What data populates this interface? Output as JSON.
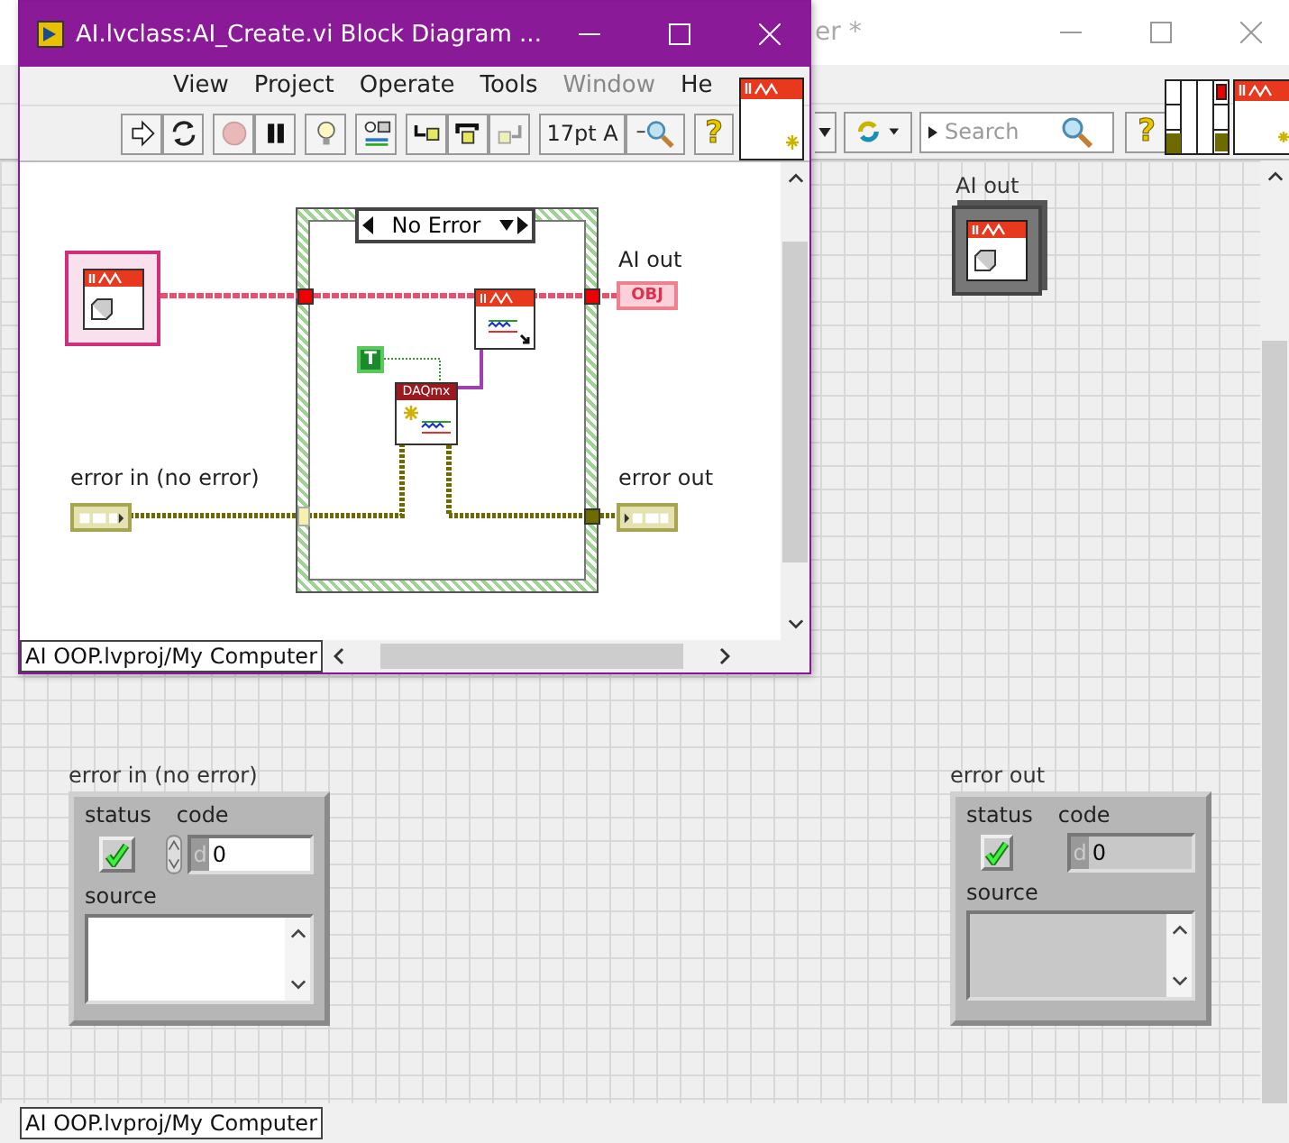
{
  "block_diagram_window": {
    "title": "AI.lvclass:AI_Create.vi Block Diagram ...",
    "menu": [
      {
        "label": "View",
        "disabled": false
      },
      {
        "label": "Project",
        "disabled": false
      },
      {
        "label": "Operate",
        "disabled": false
      },
      {
        "label": "Tools",
        "disabled": false
      },
      {
        "label": "Window",
        "disabled": true
      },
      {
        "label": "He",
        "disabled": false
      }
    ],
    "toolbar": {
      "buttons": [
        {
          "kind": "run",
          "disabled": false
        },
        {
          "kind": "run-continuously",
          "disabled": false
        },
        {
          "kind": "abort",
          "disabled": true
        },
        {
          "kind": "pause",
          "disabled": false
        },
        {
          "kind": "highlight",
          "disabled": false
        },
        {
          "kind": "retain",
          "disabled": false
        },
        {
          "kind": "step-into",
          "disabled": false
        },
        {
          "kind": "step-over",
          "disabled": false
        },
        {
          "kind": "step-out",
          "disabled": true
        }
      ],
      "font": "17pt A",
      "help": "?"
    },
    "diagram": {
      "case_selector": "No Error",
      "ai_out": {
        "label": "AI out",
        "text": "OBJ"
      },
      "error_in": {
        "label": "error in (no error)"
      },
      "error_out": {
        "label": "error out"
      },
      "boolean_constant": "T",
      "daqmx_node": "DAQmx"
    },
    "status_bar": "AI OOP.lvproj/My Computer"
  },
  "front_panel_window": {
    "title": "er *",
    "search": {
      "placeholder": "Search"
    },
    "help": "?",
    "ai_out": {
      "label": "AI out"
    },
    "error_clusters": [
      {
        "label": "error in (no error)",
        "editable": true,
        "status_label": "status",
        "ok": true,
        "code_label": "code",
        "radix": "d",
        "code": "0",
        "source_label": "source"
      },
      {
        "label": "error out",
        "editable": false,
        "status_label": "status",
        "ok": true,
        "code_label": "code",
        "radix": "d",
        "code": "0",
        "source_label": "source"
      }
    ],
    "status_bar": "AI OOP.lvproj/My Computer"
  }
}
